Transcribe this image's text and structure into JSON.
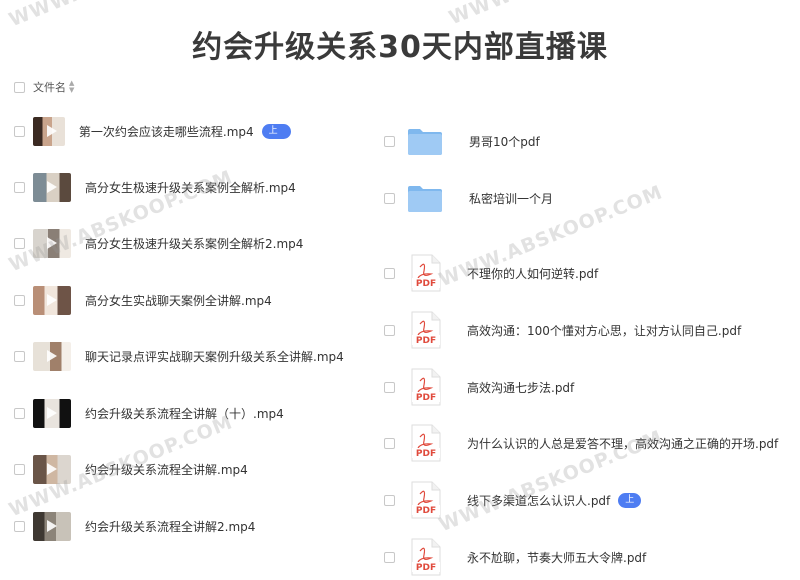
{
  "title": "约会升级关系30天内部直播课",
  "header": {
    "name_label": "文件名",
    "sort_icon": "sort-icon"
  },
  "watermark": "WWW.ABSKOOP.COM",
  "left_files": [
    {
      "name": "第一次约会应该走哪些流程.mp4",
      "badge": "上次",
      "icon": "video-thumbnail"
    },
    {
      "name": "高分女生极速升级关系案例全解析.mp4",
      "icon": "video-thumbnail"
    },
    {
      "name": "高分女生极速升级关系案例全解析2.mp4",
      "icon": "video-thumbnail"
    },
    {
      "name": "高分女生实战聊天案例全讲解.mp4",
      "icon": "video-thumbnail"
    },
    {
      "name": "聊天记录点评实战聊天案例升级关系全讲解.mp4",
      "icon": "video-thumbnail"
    },
    {
      "name": "约会升级关系流程全讲解（十）.mp4",
      "icon": "video-thumbnail"
    },
    {
      "name": "约会升级关系流程全讲解.mp4",
      "icon": "video-thumbnail"
    },
    {
      "name": "约会升级关系流程全讲解2.mp4",
      "icon": "video-thumbnail"
    }
  ],
  "right_files": [
    {
      "name": "男哥10个pdf",
      "icon": "folder-icon"
    },
    {
      "name": "私密培训一个月",
      "icon": "folder-icon"
    },
    {
      "name": "不理你的人如何逆转.pdf",
      "icon": "pdf-icon",
      "icon_text": "PDF"
    },
    {
      "name": "高效沟通：100个懂对方心思，让对方认同自己.pdf",
      "icon": "pdf-icon",
      "icon_text": "PDF"
    },
    {
      "name": "高效沟通七步法.pdf",
      "icon": "pdf-icon",
      "icon_text": "PDF"
    },
    {
      "name": "为什么认识的人总是爱答不理，高效沟通之正确的开场.pdf",
      "icon": "pdf-icon",
      "icon_text": "PDF"
    },
    {
      "name": "线下多渠道怎么认识人.pdf",
      "badge": "上次",
      "icon": "pdf-icon",
      "icon_text": "PDF"
    },
    {
      "name": "永不尬聊，节奏大师五大令牌.pdf",
      "icon": "pdf-icon",
      "icon_text": "PDF"
    }
  ],
  "colors": {
    "badge": "#4e7df2",
    "folder": "#8fc3f2",
    "pdf_red": "#e04a3c",
    "title": "#3a3a3a"
  }
}
